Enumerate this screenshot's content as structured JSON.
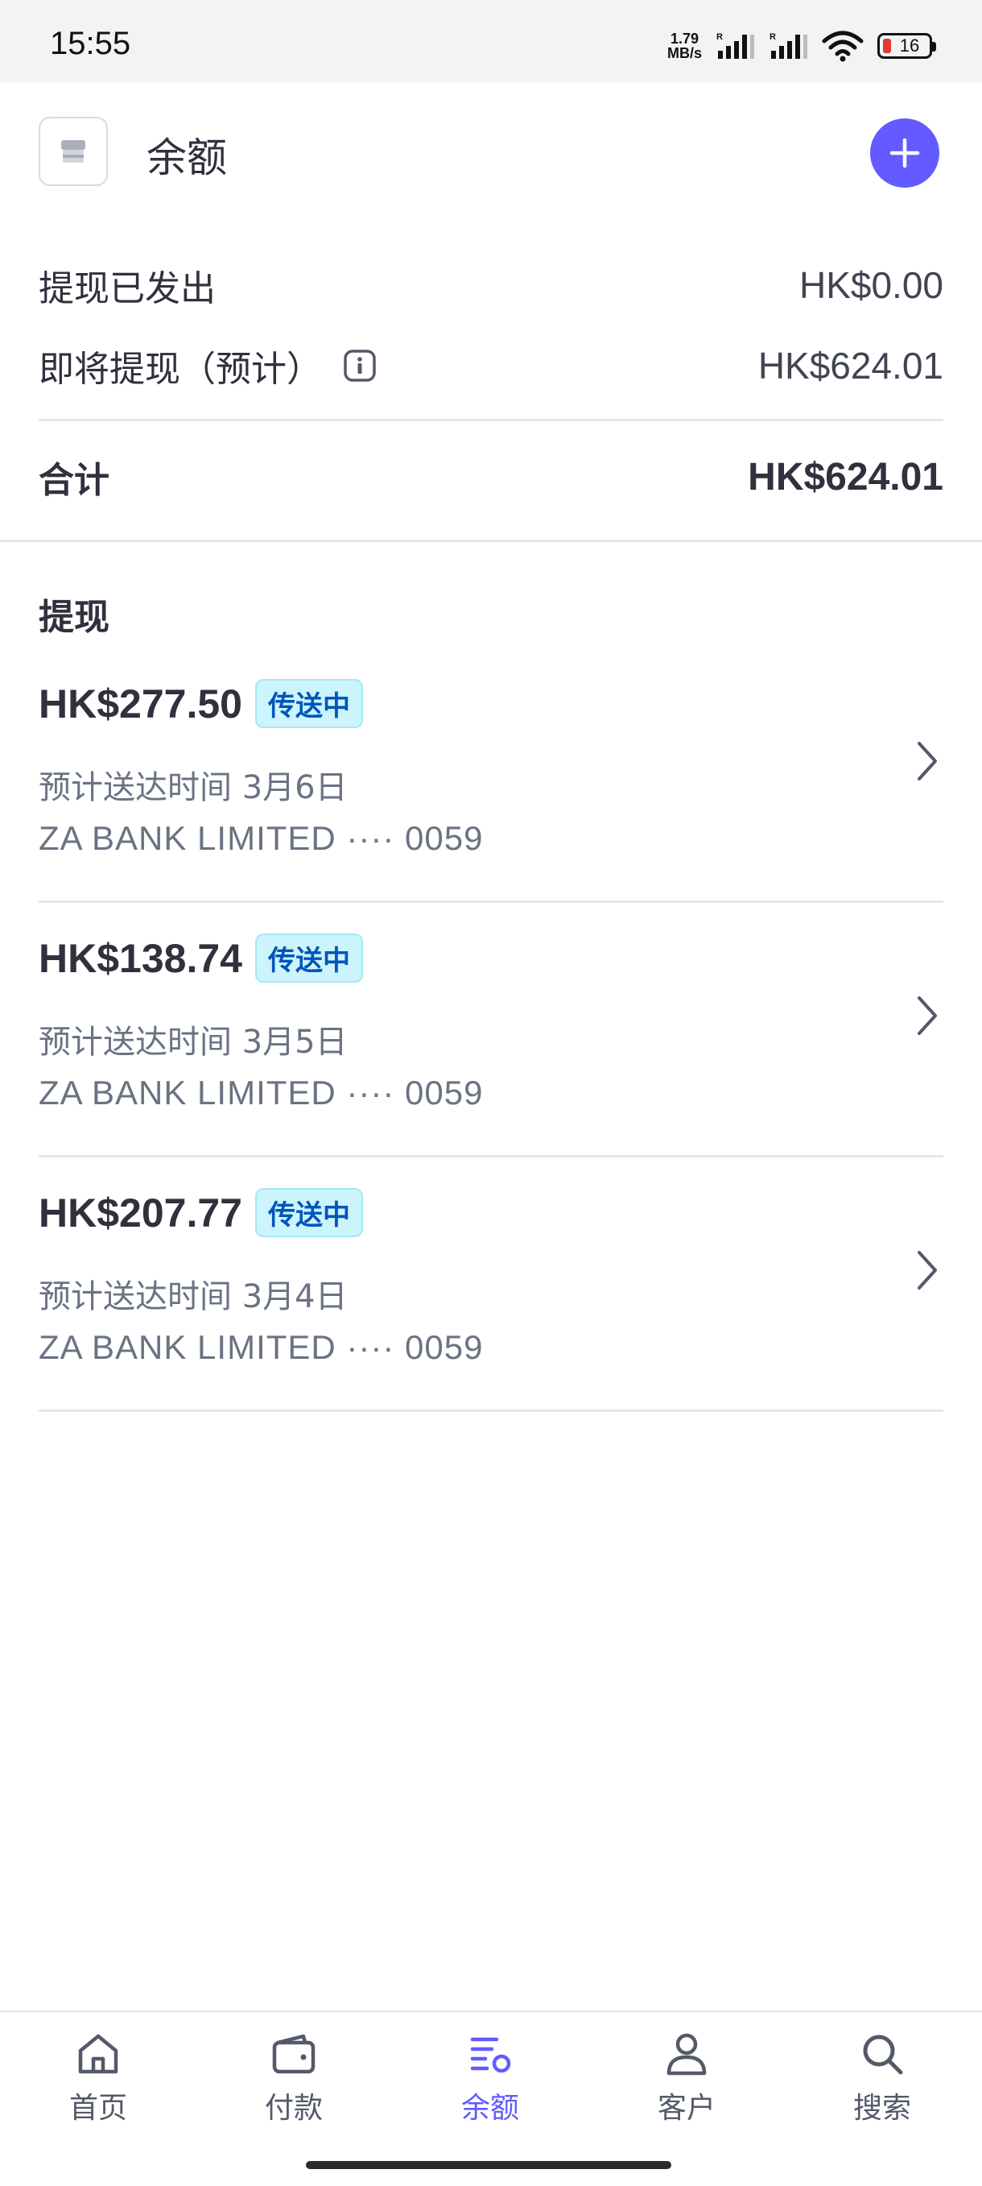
{
  "status_bar": {
    "time": "15:55",
    "net_speed_value": "1.79",
    "net_speed_unit": "MB/s",
    "battery_level": "16",
    "icons": [
      "signal-icon",
      "signal-icon",
      "wifi-icon",
      "battery-icon"
    ]
  },
  "header": {
    "title": "余额",
    "store_icon": "store-icon",
    "add_icon": "plus-icon"
  },
  "summary": {
    "sent_label": "提现已发出",
    "sent_value": "HK$0.00",
    "upcoming_label": "即将提现（预计）",
    "upcoming_value": "HK$624.01",
    "total_label": "合计",
    "total_value": "HK$624.01"
  },
  "payouts": {
    "title": "提现",
    "items": [
      {
        "amount": "HK$277.50",
        "status": "传送中",
        "eta": "预计送达时间 3月6日",
        "bank": "ZA BANK LIMITED ···· 0059"
      },
      {
        "amount": "HK$138.74",
        "status": "传送中",
        "eta": "预计送达时间 3月5日",
        "bank": "ZA BANK LIMITED ···· 0059"
      },
      {
        "amount": "HK$207.77",
        "status": "传送中",
        "eta": "预计送达时间 3月4日",
        "bank": "ZA BANK LIMITED ···· 0059"
      }
    ]
  },
  "nav": {
    "items": [
      {
        "label": "首页",
        "icon": "home-icon"
      },
      {
        "label": "付款",
        "icon": "wallet-icon"
      },
      {
        "label": "余额",
        "icon": "balance-icon",
        "active": true
      },
      {
        "label": "客户",
        "icon": "person-icon"
      },
      {
        "label": "搜索",
        "icon": "search-icon"
      }
    ]
  },
  "colors": {
    "accent": "#635bff",
    "badge_bg": "#cbf4fc",
    "badge_text": "#0055bc"
  }
}
